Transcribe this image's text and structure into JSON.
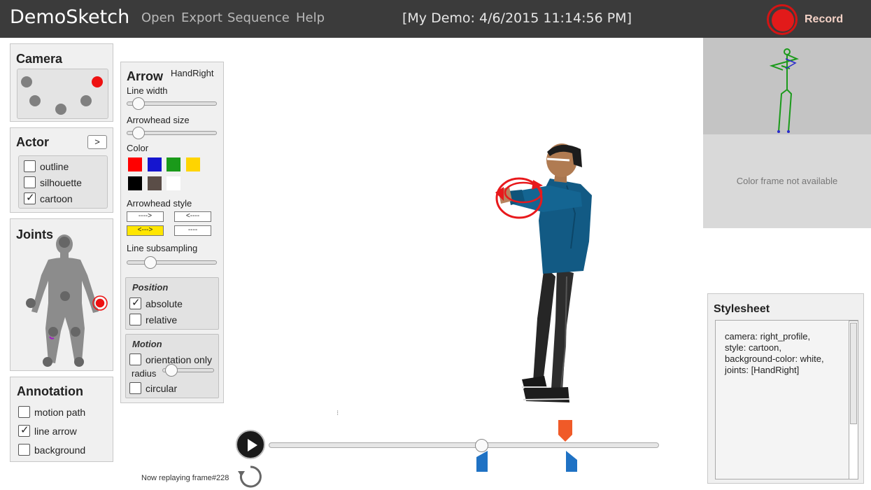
{
  "app": {
    "title": "DemoSketch"
  },
  "menu": [
    "Open",
    "Export",
    "Sequence",
    "Help"
  ],
  "document_title": "[My Demo: 4/6/2015 11:14:56 PM]",
  "record": {
    "label": "Record"
  },
  "camera_panel": {
    "title": "Camera"
  },
  "actor_panel": {
    "title": "Actor",
    "next_label": ">",
    "options": [
      {
        "label": "outline",
        "checked": false
      },
      {
        "label": "silhouette",
        "checked": false
      },
      {
        "label": "cartoon",
        "checked": true
      }
    ]
  },
  "joints_panel": {
    "title": "Joints"
  },
  "annotation_panel": {
    "title": "Annotation",
    "options": [
      {
        "label": "motion path",
        "checked": false
      },
      {
        "label": "line arrow",
        "checked": true
      },
      {
        "label": "background",
        "checked": false
      }
    ]
  },
  "arrow_panel": {
    "title": "Arrow",
    "joint": "HandRight",
    "line_width_label": "Line width",
    "arrowhead_size_label": "Arrowhead size",
    "color_label": "Color",
    "colors": [
      "#ff0000",
      "#1515cf",
      "#1a9a1a",
      "#ffd400",
      "#000000",
      "#5a4d47",
      "#ffffff"
    ],
    "arrowhead_style_label": "Arrowhead style",
    "arrowhead_styles": [
      {
        "label": "---->",
        "selected": false
      },
      {
        "label": "<----",
        "selected": false
      },
      {
        "label": "<--->",
        "selected": true
      },
      {
        "label": "----",
        "selected": false
      }
    ],
    "line_subsampling_label": "Line subsampling",
    "position": {
      "title": "Position",
      "options": [
        {
          "label": "absolute",
          "checked": true
        },
        {
          "label": "relative",
          "checked": false
        }
      ]
    },
    "motion": {
      "title": "Motion",
      "orientation_only": {
        "label": "orientation only",
        "checked": false
      },
      "radius_label": "radius",
      "circular": {
        "label": "circular",
        "checked": false
      }
    }
  },
  "preview": {
    "no_color_text": "Color frame not available"
  },
  "stylesheet": {
    "title": "Stylesheet",
    "text": "camera: right_profile,\nstyle: cartoon,\nbackground-color: white,\njoints: [HandRight]"
  },
  "playback": {
    "status": "Now replaying frame#228",
    "progress": 0.55
  },
  "accent_colors": {
    "record": "#e21a1a",
    "marker_orange": "#f05a28",
    "marker_blue": "#1f72c4",
    "selected_style": "#ffe600"
  }
}
